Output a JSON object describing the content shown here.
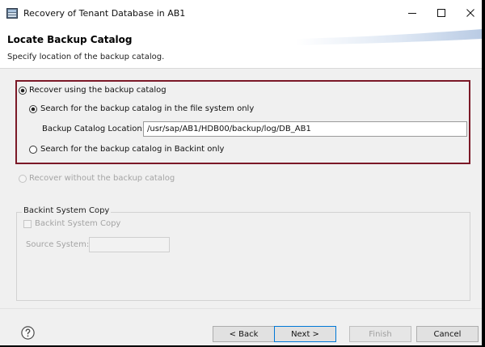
{
  "window": {
    "title": "Recovery of Tenant Database in AB1"
  },
  "header": {
    "title": "Locate Backup Catalog",
    "description": "Specify location of the backup catalog."
  },
  "options": {
    "recover_with_catalog": {
      "label": "Recover using the backup catalog",
      "selected": true
    },
    "search_file_system": {
      "label": "Search for the backup catalog in the file system only",
      "selected": true
    },
    "catalog_location": {
      "label": "Backup Catalog Location:",
      "value": "/usr/sap/AB1/HDB00/backup/log/DB_AB1"
    },
    "search_backint": {
      "label": "Search for the backup catalog in Backint only",
      "selected": false
    },
    "recover_without_catalog": {
      "label": "Recover without the backup catalog",
      "selected": false,
      "enabled": false
    }
  },
  "backint_group": {
    "title": "Backint System Copy",
    "checkbox_label": "Backint System Copy",
    "source_system_label": "Source System:",
    "source_system_value": ""
  },
  "footer": {
    "back_label": "< Back",
    "next_label": "Next >",
    "finish_label": "Finish",
    "cancel_label": "Cancel"
  },
  "colors": {
    "highlight_border": "#7b1927",
    "default_button_border": "#0078d7"
  },
  "icons": {
    "app": "database-recovery-icon",
    "help": "help-icon",
    "minimize": "minimize-icon",
    "maximize": "maximize-icon",
    "close": "close-icon"
  }
}
